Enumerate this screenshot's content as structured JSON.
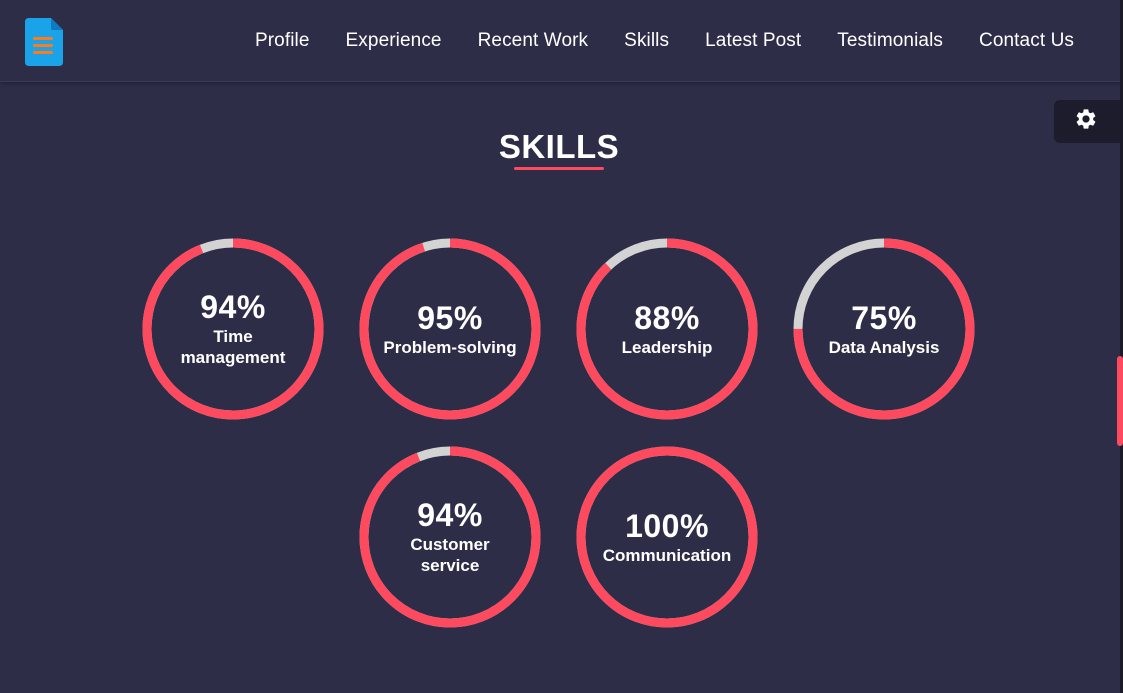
{
  "header": {
    "logo_icon": "document-list-icon",
    "nav": [
      {
        "label": "Profile"
      },
      {
        "label": "Experience"
      },
      {
        "label": "Recent Work"
      },
      {
        "label": "Skills"
      },
      {
        "label": "Latest Post"
      },
      {
        "label": "Testimonials"
      },
      {
        "label": "Contact Us"
      }
    ]
  },
  "settings": {
    "icon": "gear-icon"
  },
  "section": {
    "title": "SKILLS"
  },
  "colors": {
    "background": "#2e2d48",
    "accent": "#fd4a5f",
    "ring_track": "#d3d3d3",
    "settings_bg": "#1c1c2d"
  },
  "skills": [
    {
      "percent_text": "94%",
      "percent": 94,
      "label": "Time management"
    },
    {
      "percent_text": "95%",
      "percent": 95,
      "label": "Problem-solving"
    },
    {
      "percent_text": "88%",
      "percent": 88,
      "label": "Leadership"
    },
    {
      "percent_text": "75%",
      "percent": 75,
      "label": "Data Analysis"
    },
    {
      "percent_text": "94%",
      "percent": 94,
      "label": "Customer service"
    },
    {
      "percent_text": "100%",
      "percent": 100,
      "label": "Communication"
    }
  ]
}
